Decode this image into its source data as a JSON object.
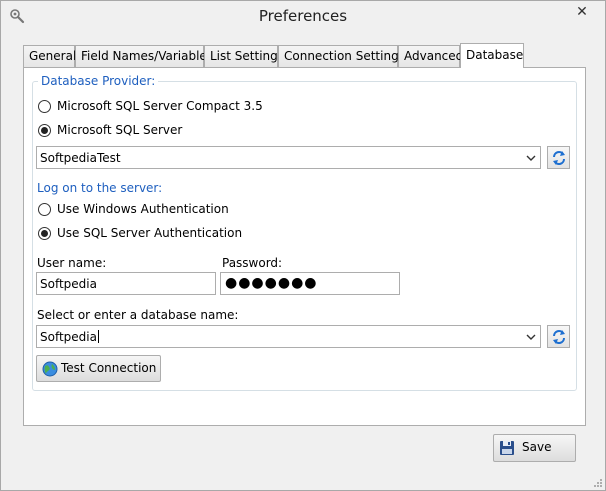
{
  "window": {
    "title": "Preferences",
    "close_glyph": "✕",
    "icon": "wrench-gear-icon"
  },
  "tabs": [
    {
      "label": "General",
      "active": false
    },
    {
      "label": "Field Names/Variables",
      "active": false
    },
    {
      "label": "List Settings",
      "active": false
    },
    {
      "label": "Connection Settings",
      "active": false
    },
    {
      "label": "Advanced",
      "active": false
    },
    {
      "label": "Database",
      "active": true
    }
  ],
  "database_provider": {
    "legend": "Database Provider:",
    "options": [
      {
        "label": "Microsoft SQL Server Compact 3.5",
        "checked": false
      },
      {
        "label": "Microsoft SQL Server",
        "checked": true
      }
    ],
    "server_value": "SoftpediaTest"
  },
  "logon": {
    "label": "Log on to the server:",
    "options": [
      {
        "label": "Use Windows Authentication",
        "checked": false
      },
      {
        "label": "Use SQL Server Authentication",
        "checked": true
      }
    ],
    "username_label": "User name:",
    "username_value": "Softpedia",
    "password_label": "Password:",
    "password_value": "●●●●●●●"
  },
  "database": {
    "label": "Select or enter a database name:",
    "value": "Softpedia",
    "test_button_label": "Test Connection"
  },
  "footer": {
    "save_label": "Save"
  },
  "colors": {
    "section_label": "#1e5fbf",
    "refresh_icon": "#1e6fd0"
  }
}
